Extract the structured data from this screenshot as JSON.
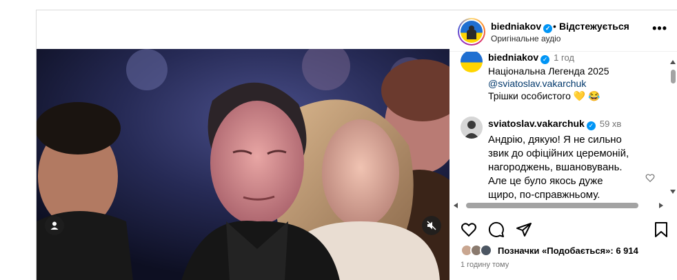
{
  "post": {
    "author": "biedniakov",
    "follow_dot": "•",
    "follow_label": "Відстежується",
    "audio_label": "Оригінальне аудіо",
    "more_label": "•••"
  },
  "comments": [
    {
      "user": "biedniakov",
      "time": "1 год",
      "lines": [
        "Національна Легенда 2025",
        "@sviatoslav.vakarchuk",
        "Трішки особистого 💛 😂"
      ]
    },
    {
      "user": "sviatoslav.vakarchuk",
      "time": "59 хв",
      "lines": [
        "Андрію, дякую! Я не сильно",
        "звик до офіційних церемоній,",
        "нагороджень, вшановувань.",
        "Але це було якось дуже",
        "щиро, по-справжньому."
      ]
    }
  ],
  "likes": {
    "label": "Позначки «Подобається»:",
    "count": "6 914"
  },
  "time_ago": "1 годину тому",
  "colors": {
    "verified": "#0095f6",
    "link": "#00376b",
    "muted": "#737373"
  }
}
